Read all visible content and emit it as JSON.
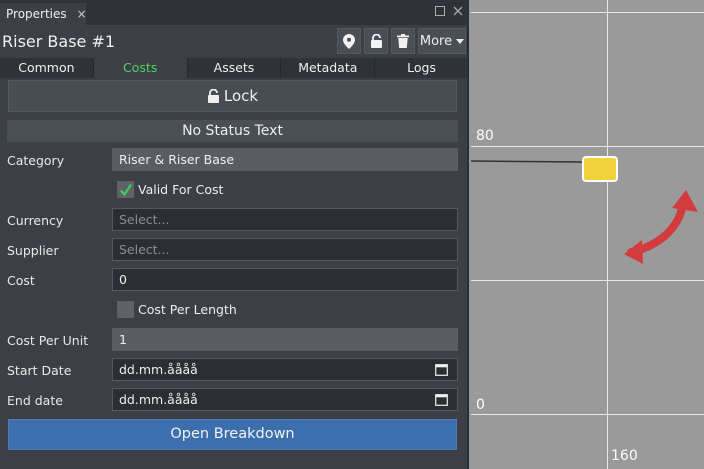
{
  "panel": {
    "tab_title": "Properties",
    "close_glyph": "×",
    "object_title": "Riser Base #1",
    "toolbar": {
      "more_label": "More",
      "pin_icon": "location-pin-icon",
      "lock_icon": "unlock-icon",
      "trash_icon": "trash-icon"
    },
    "tabs": [
      {
        "label": "Common",
        "active": false
      },
      {
        "label": "Costs",
        "active": true
      },
      {
        "label": "Assets",
        "active": false
      },
      {
        "label": "Metadata",
        "active": false
      },
      {
        "label": "Logs",
        "active": false
      }
    ],
    "lock_label": "Lock",
    "status_text": "No Status Text",
    "fields": {
      "category": {
        "label": "Category",
        "value": "Riser & Riser Base"
      },
      "valid_for_cost": {
        "label": "Valid For Cost",
        "checked": true
      },
      "currency": {
        "label": "Currency",
        "placeholder": "Select..."
      },
      "supplier": {
        "label": "Supplier",
        "placeholder": "Select..."
      },
      "cost": {
        "label": "Cost",
        "value": "0"
      },
      "cost_per_length": {
        "label": "Cost Per Length",
        "checked": false
      },
      "cost_per_unit": {
        "label": "Cost Per Unit",
        "value": "1"
      },
      "start_date": {
        "label": "Start Date",
        "value": "dd.mm.åååå"
      },
      "end_date": {
        "label": "End date",
        "value": "dd.mm.åååå"
      }
    },
    "open_breakdown_label": "Open Breakdown"
  },
  "viewport": {
    "labels": {
      "y80": "80",
      "y0": "0",
      "x160": "160"
    },
    "colors": {
      "node_fill": "#f2d23a",
      "rotate_arrow": "#d23c3c"
    }
  }
}
